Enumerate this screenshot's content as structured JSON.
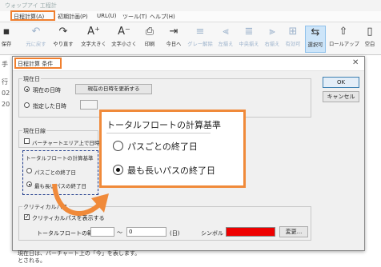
{
  "app": {
    "title": "ウォップアイ 工程計",
    "menus": [
      "日程計算(A)",
      "初期計画(P)",
      "URL(U)",
      "ツール(T)",
      "ヘルプ(H)"
    ],
    "toolbar": [
      {
        "label": "",
        "icon": "save-icon"
      },
      {
        "label": "元に戻す",
        "icon": "undo-icon"
      },
      {
        "label": "やり直す",
        "icon": "redo-icon"
      },
      {
        "label": "文字大きく",
        "icon": "font-larger-icon"
      },
      {
        "label": "文字小さく",
        "icon": "font-smaller-icon"
      },
      {
        "label": "印刷",
        "icon": "print-icon"
      },
      {
        "label": "今日へ",
        "icon": "today-icon"
      },
      {
        "label": "グレー解除",
        "icon": "gray-clear-icon"
      },
      {
        "label": "左揃え",
        "icon": "align-left-icon"
      },
      {
        "label": "中央揃え",
        "icon": "align-center-icon"
      },
      {
        "label": "右揃え",
        "icon": "align-right-icon"
      },
      {
        "label": "有効可",
        "icon": "enable-icon"
      },
      {
        "label": "選択可",
        "icon": "select-icon"
      },
      {
        "label": "ロールアップ",
        "icon": "rollup-icon"
      },
      {
        "label": "空白",
        "icon": "blank-icon"
      }
    ],
    "left_fragments": [
      "保存",
      "手",
      "行",
      "02",
      "20"
    ],
    "doc_bottom": [
      "現在日は、バーチャート上の「今」を表します。",
      "とされる。"
    ]
  },
  "dialog": {
    "title": "日程計算 条件",
    "ok": "OK",
    "cancel": "キャンセル",
    "current_date": {
      "group": "現在日",
      "opt_today": "現在の日時",
      "update_button": "現在の日時を更新する",
      "opt_specified": "指定した日時"
    },
    "current_line": {
      "group": "現在日線",
      "checkbox": "バーチャートエリア上で日時線"
    },
    "total_float": {
      "group": "トータルフロートの計算基準",
      "opt_each_path": "パスごとの終了日",
      "opt_longest_path": "最も長いパスの終了日"
    },
    "critical_path": {
      "group": "クリティカルパス",
      "checkbox": "クリティカルパスを表示する",
      "range_label": "トータルフロートの範囲",
      "range_from": "",
      "range_sep": "〜",
      "range_to": "0",
      "unit": "(日)",
      "symbol_label": "シンボル",
      "symbol_color": "#ee0000",
      "change_button": "変更..."
    }
  },
  "callout": {
    "title": "トータルフロートの計算基準",
    "opt_each_path": "パスごとの終了日",
    "opt_longest_path": "最も長いパスの終了日",
    "selected": "opt_longest_path",
    "accent": "#f08a3a"
  }
}
